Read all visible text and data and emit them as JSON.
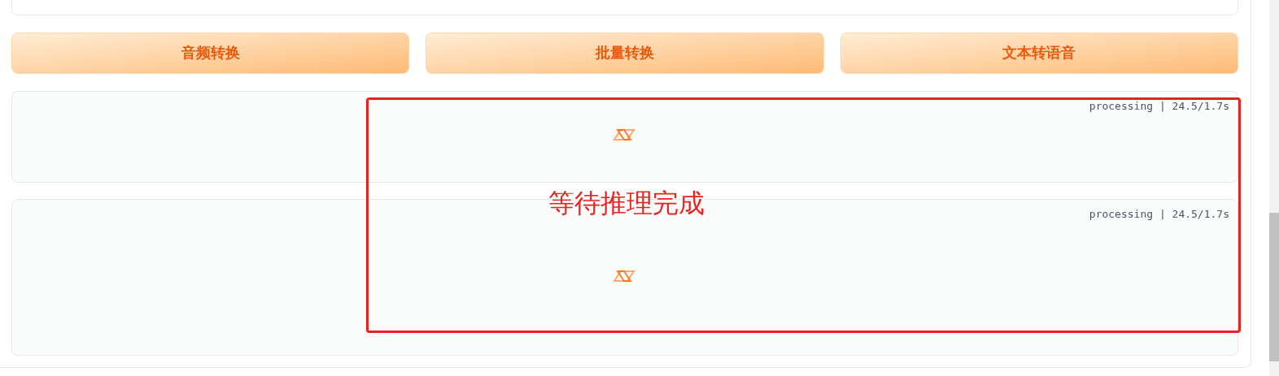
{
  "buttons": [
    {
      "label": "音频转换"
    },
    {
      "label": "批量转换"
    },
    {
      "label": "文本转语音"
    }
  ],
  "outputs": [
    {
      "status": "processing | 24.5/1.7s"
    },
    {
      "status": "processing | 24.5/1.7s"
    }
  ],
  "annotation": {
    "text": "等待推理完成"
  }
}
